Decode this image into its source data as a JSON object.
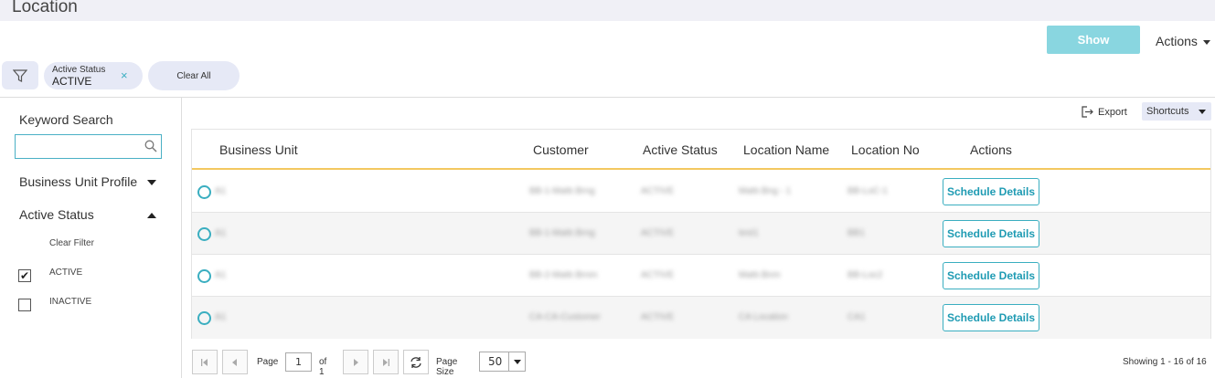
{
  "page": {
    "title": "Location"
  },
  "toolbar": {
    "show_label": "Show",
    "actions_label": "Actions"
  },
  "filters": {
    "chip": {
      "label": "Active Status",
      "value": "ACTIVE",
      "remove": "×"
    },
    "clear_all": "Clear All"
  },
  "sidebar": {
    "keyword_search": "Keyword Search",
    "keyword_value": "",
    "business_unit_profile": "Business Unit Profile",
    "active_status": "Active Status",
    "clear_filter": "Clear Filter",
    "options": [
      {
        "label": "ACTIVE",
        "checked": true
      },
      {
        "label": "INACTIVE",
        "checked": false
      }
    ]
  },
  "grid_toolbar": {
    "export": "Export",
    "shortcuts": "Shortcuts"
  },
  "table": {
    "columns": [
      "Business Unit",
      "Customer",
      "Active Status",
      "Location Name",
      "Location No",
      "Actions"
    ],
    "rows": [
      {
        "business_unit": "A1",
        "customer": "BB-1-Mattr.Brng",
        "status": "ACTIVE",
        "location_name": "Mattr.Bng - 1",
        "location_no": "BB-LoC-1",
        "action": "Schedule Details"
      },
      {
        "business_unit": "A1",
        "customer": "BB-1-Mattr.Brng",
        "status": "ACTIVE",
        "location_name": "test1",
        "location_no": "BB1",
        "action": "Schedule Details"
      },
      {
        "business_unit": "A1",
        "customer": "BB-2-Mattr.Brnm",
        "status": "ACTIVE",
        "location_name": "Mattr.Bnm",
        "location_no": "BB-Loc2",
        "action": "Schedule Details"
      },
      {
        "business_unit": "A1",
        "customer": "CA-CA-Customer",
        "status": "ACTIVE",
        "location_name": "CA Location",
        "location_no": "CA1",
        "action": "Schedule Details"
      }
    ]
  },
  "pager": {
    "page_label": "Page",
    "page": "1",
    "of_label": "of 1",
    "page_size_label": "Page Size",
    "page_size": "50",
    "showing": "Showing 1 - 16 of 16"
  }
}
